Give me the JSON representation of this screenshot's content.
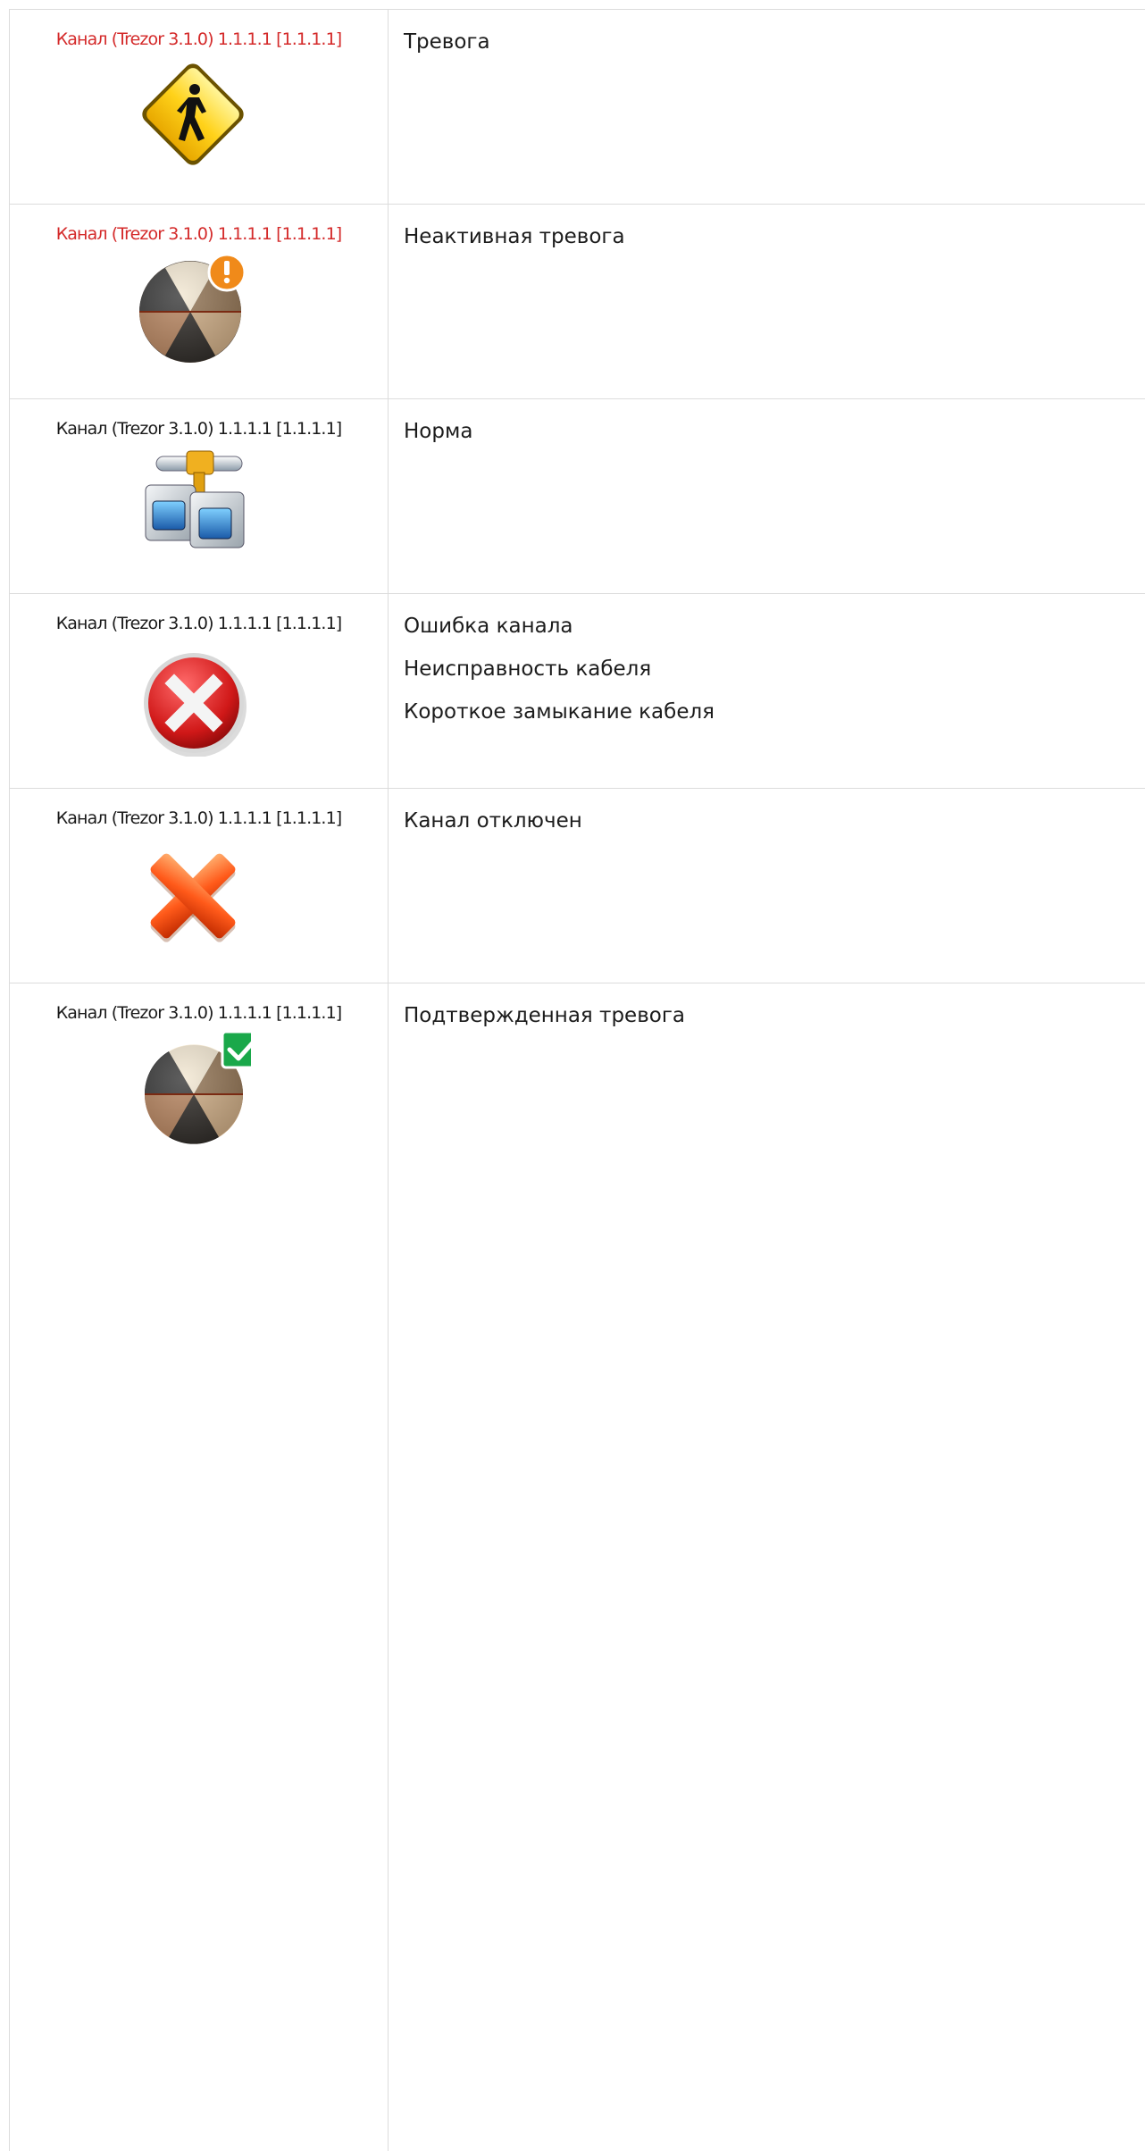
{
  "rows": [
    {
      "channel_label": "Канал (Trezor 3.1.0) 1.1.1.1 [1.1.1.1]",
      "label_color": "#d42a2a",
      "icon": "pedestrian-warning-icon",
      "descriptions": [
        "Тревога"
      ]
    },
    {
      "channel_label": "Канал (Trezor 3.1.0) 1.1.1.1 [1.1.1.1]",
      "label_color": "#d42a2a",
      "icon": "inactive-alarm-icon",
      "descriptions": [
        "Неактивная тревога"
      ]
    },
    {
      "channel_label": "Канал (Trezor 3.1.0) 1.1.1.1 [1.1.1.1]",
      "label_color": "#1a1a1a",
      "icon": "network-channel-icon",
      "descriptions": [
        "Норма"
      ]
    },
    {
      "channel_label": "Канал (Trezor 3.1.0) 1.1.1.1 [1.1.1.1]",
      "label_color": "#1a1a1a",
      "icon": "error-circle-icon",
      "descriptions": [
        "Ошибка канала",
        "Неисправность кабеля",
        "Короткое замыкание кабеля"
      ]
    },
    {
      "channel_label": "Канал (Trezor 3.1.0) 1.1.1.1 [1.1.1.1]",
      "label_color": "#1a1a1a",
      "icon": "disabled-cross-icon",
      "descriptions": [
        "Канал отключен"
      ]
    },
    {
      "channel_label": "Канал (Trezor 3.1.0) 1.1.1.1 [1.1.1.1]",
      "label_color": "#1a1a1a",
      "icon": "confirmed-alarm-icon",
      "descriptions": [
        "Подтвержденная тревога"
      ]
    }
  ]
}
